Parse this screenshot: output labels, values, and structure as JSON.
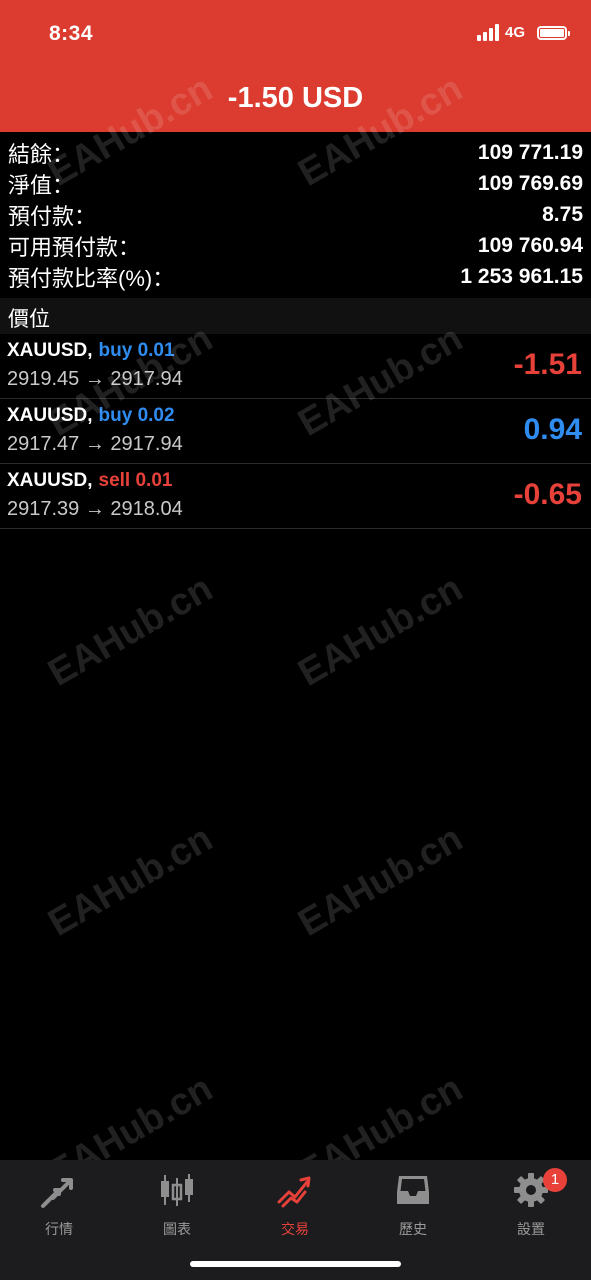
{
  "status_bar": {
    "time": "8:34",
    "network": "4G",
    "battery_level": 1.0
  },
  "header": {
    "title": "-1.50 USD",
    "background_color": "#db3c2f"
  },
  "summary": [
    {
      "label": "結餘：",
      "value": "109 771.19"
    },
    {
      "label": "淨值：",
      "value": "109 769.69"
    },
    {
      "label": "預付款：",
      "value": "8.75"
    },
    {
      "label": "可用預付款：",
      "value": "109 760.94"
    },
    {
      "label": "預付款比率(%)：",
      "value": "1 253 961.15"
    }
  ],
  "positions_section": {
    "title": "價位"
  },
  "positions": [
    {
      "symbol": "XAUUSD,",
      "type": "buy 0.01",
      "prices": "2919.45 → 2917.94",
      "profit": "-1.51",
      "type_color": "blue",
      "profit_color": "red"
    },
    {
      "symbol": "XAUUSD,",
      "type": "buy 0.02",
      "prices": "2917.47 → 2917.94",
      "profit": "0.94",
      "type_color": "blue",
      "profit_color": "blue"
    },
    {
      "symbol": "XAUUSD,",
      "type": "sell 0.01",
      "prices": "2917.39 → 2918.04",
      "profit": "-0.65",
      "type_color": "red",
      "profit_color": "red"
    }
  ],
  "watermark": "EAHub.cn",
  "tabs": [
    {
      "label": "行情",
      "icon": "quotes-arrows-icon",
      "active": false
    },
    {
      "label": "圖表",
      "icon": "candlestick-chart-icon",
      "active": false
    },
    {
      "label": "交易",
      "icon": "trade-trend-icon",
      "active": true
    },
    {
      "label": "歷史",
      "icon": "history-inbox-icon",
      "active": false
    },
    {
      "label": "設置",
      "icon": "settings-gear-icon",
      "active": false,
      "badge": "1"
    }
  ],
  "colors": {
    "accent_red": "#e8413a",
    "accent_blue": "#2f8cf0",
    "tab_inactive": "#9a9a9a"
  }
}
